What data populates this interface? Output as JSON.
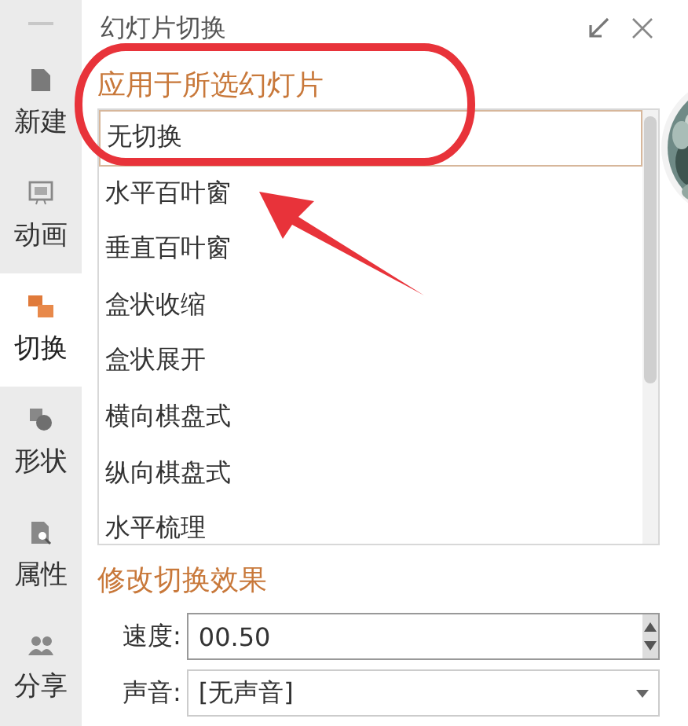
{
  "sidebar": {
    "items": [
      {
        "label": "新建",
        "selected": false
      },
      {
        "label": "动画",
        "selected": false
      },
      {
        "label": "切换",
        "selected": true
      },
      {
        "label": "形状",
        "selected": false
      },
      {
        "label": "属性",
        "selected": false
      },
      {
        "label": "分享",
        "selected": false
      }
    ]
  },
  "panel": {
    "title": "幻灯片切换",
    "apply_heading": "应用于所选幻灯片",
    "effects": [
      {
        "label": "无切换",
        "selected": true
      },
      {
        "label": "水平百叶窗",
        "selected": false
      },
      {
        "label": "垂直百叶窗",
        "selected": false
      },
      {
        "label": "盒状收缩",
        "selected": false
      },
      {
        "label": "盒状展开",
        "selected": false
      },
      {
        "label": "横向棋盘式",
        "selected": false
      },
      {
        "label": "纵向棋盘式",
        "selected": false
      },
      {
        "label": "水平梳理",
        "selected": false
      }
    ],
    "modify_heading": "修改切换效果",
    "fields": [
      {
        "kind": "spinner",
        "label": "速度:",
        "value": "00.50"
      },
      {
        "kind": "dropdown",
        "label": "声音:",
        "value": "[无声音]"
      }
    ]
  }
}
